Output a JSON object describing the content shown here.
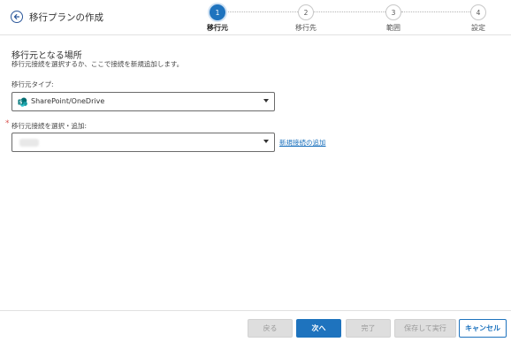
{
  "header": {
    "title": "移行プランの作成"
  },
  "stepper": {
    "steps": [
      {
        "number": "1",
        "label": "移行元",
        "active": true
      },
      {
        "number": "2",
        "label": "移行先",
        "active": false
      },
      {
        "number": "3",
        "label": "範囲",
        "active": false
      },
      {
        "number": "4",
        "label": "設定",
        "active": false
      }
    ]
  },
  "section": {
    "title": "移行元となる場所",
    "description": "移行元接続を選択するか、ここで接続を新規追加します。"
  },
  "source_type": {
    "label": "移行元タイプ:",
    "value": "SharePoint/OneDrive",
    "icon": "sharepoint-icon"
  },
  "source_connection": {
    "required_mark": "*",
    "label": "移行元接続を選択・追加:",
    "value": "",
    "add_link": "新規接続の追加"
  },
  "footer": {
    "back": "戻る",
    "next": "次へ",
    "finish": "完了",
    "save_run": "保存して実行",
    "cancel": "キャンセル"
  },
  "colors": {
    "accent": "#1e73be",
    "required": "#d9534f",
    "disabled_bg": "#dedede"
  }
}
